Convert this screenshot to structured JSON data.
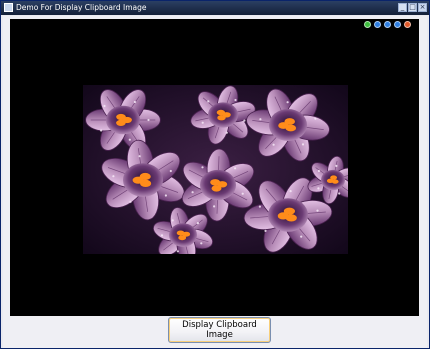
{
  "window": {
    "title": "Demo For Display Clipboard Image"
  },
  "toolbar": {
    "icons": [
      {
        "name": "nav-icon-1",
        "color": "#3fbf3f"
      },
      {
        "name": "nav-icon-2",
        "color": "#2f7fe0"
      },
      {
        "name": "nav-icon-3",
        "color": "#2f7fe0"
      },
      {
        "name": "nav-icon-4",
        "color": "#2f7fe0"
      },
      {
        "name": "nav-icon-5",
        "color": "#e05a2a"
      }
    ]
  },
  "image": {
    "subject": "crocus flowers",
    "colors": {
      "petal": "#b58ab6",
      "petal_dark": "#6a3a73",
      "stamen": "#ff8c1a",
      "background": "#1a0d1f"
    }
  },
  "button": {
    "label": "Display Clipboard Image"
  }
}
